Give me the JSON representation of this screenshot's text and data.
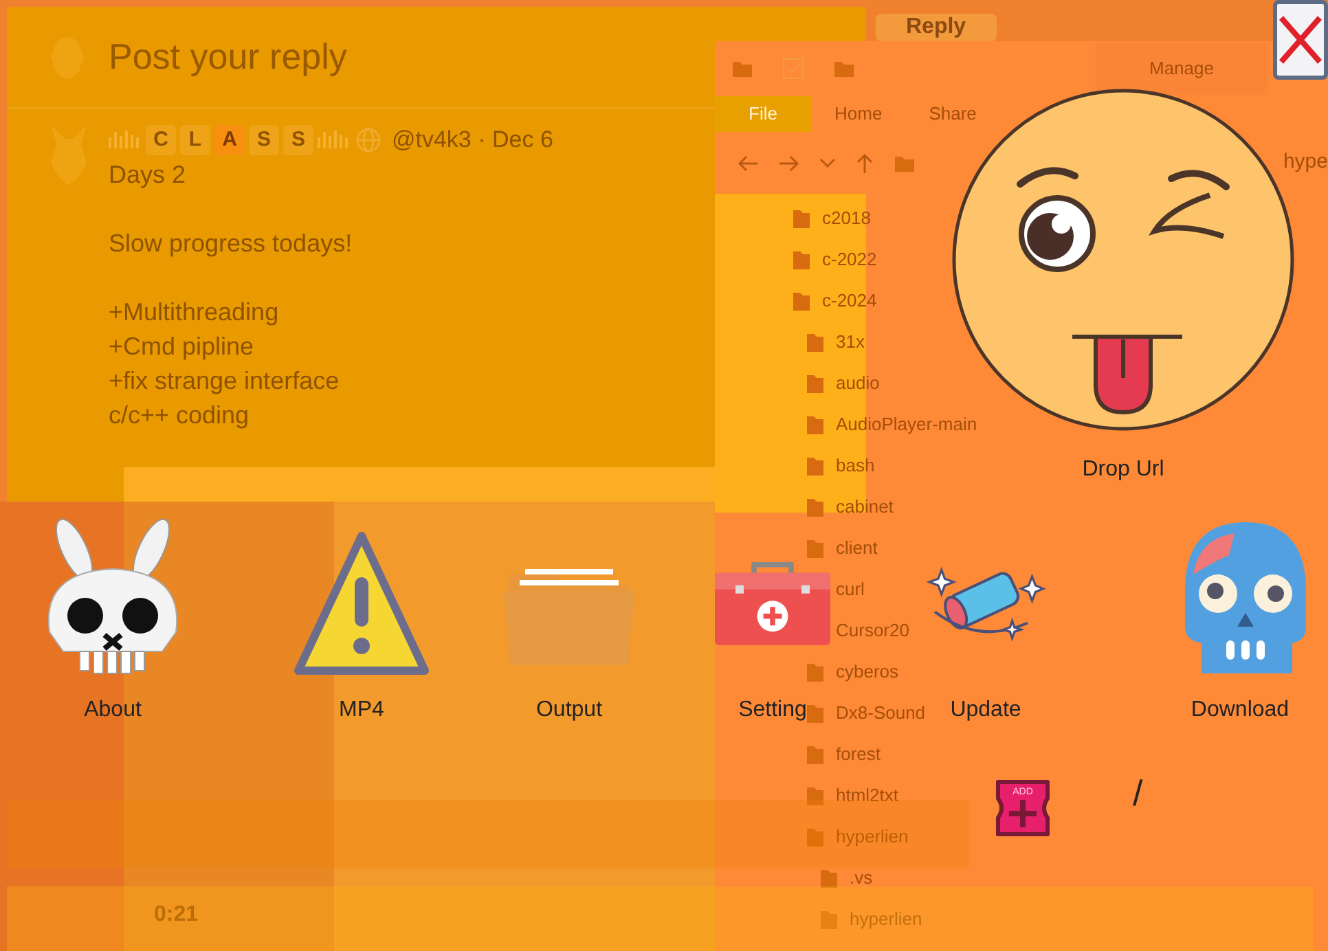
{
  "background": {
    "tweet_window": {
      "reply_placeholder": "Post your reply",
      "reply_button": "Reply",
      "badge_letters": [
        {
          "text": "C",
          "highlighted": false
        },
        {
          "text": "L",
          "highlighted": false
        },
        {
          "text": "A",
          "highlighted": true
        },
        {
          "text": "S",
          "highlighted": false
        },
        {
          "text": "S",
          "highlighted": false
        }
      ],
      "meta": "@tv4k3 · Dec 6",
      "paragraphs": [
        [
          "Days 2"
        ],
        [
          "Slow progress todays!"
        ],
        [
          "+Multithreading",
          "+Cmd pipline",
          "+fix strange interface",
          "c/c++ coding"
        ]
      ]
    },
    "explorer": {
      "context_tab": "Manage",
      "tabs": [
        {
          "label": "File",
          "selected": true
        },
        {
          "label": "Home",
          "selected": false
        },
        {
          "label": "Share",
          "selected": false
        }
      ],
      "breadcrumb": [
        "hype"
      ],
      "folders": [
        {
          "name": "c2018"
        },
        {
          "name": "c-2022"
        },
        {
          "name": "c-2024",
          "children": [
            {
              "name": "31x"
            },
            {
              "name": "audio"
            },
            {
              "name": "AudioPlayer-main"
            },
            {
              "name": "bash"
            },
            {
              "name": "cabinet"
            },
            {
              "name": "client"
            },
            {
              "name": "curl"
            },
            {
              "name": "Cursor20"
            },
            {
              "name": "cyberos"
            },
            {
              "name": "Dx8-Sound"
            },
            {
              "name": "forest"
            },
            {
              "name": "html2txt"
            },
            {
              "name": "hyperlien",
              "children": [
                {
                  "name": ".vs"
                },
                {
                  "name": "hyperlien"
                }
              ]
            }
          ]
        }
      ]
    },
    "video_window": {
      "time": "0:21"
    }
  },
  "app": {
    "drop_label": "Drop Url",
    "actions": [
      {
        "label": "About",
        "kind": "bunny"
      },
      {
        "label": "MP4",
        "kind": "warning"
      },
      {
        "label": "Output",
        "kind": "folder"
      },
      {
        "label": "Setting",
        "kind": "kit"
      },
      {
        "label": "Update",
        "kind": "telescope"
      },
      {
        "label": "Download",
        "kind": "skull"
      }
    ],
    "add_icon_text": "ADD",
    "separator": "/"
  }
}
